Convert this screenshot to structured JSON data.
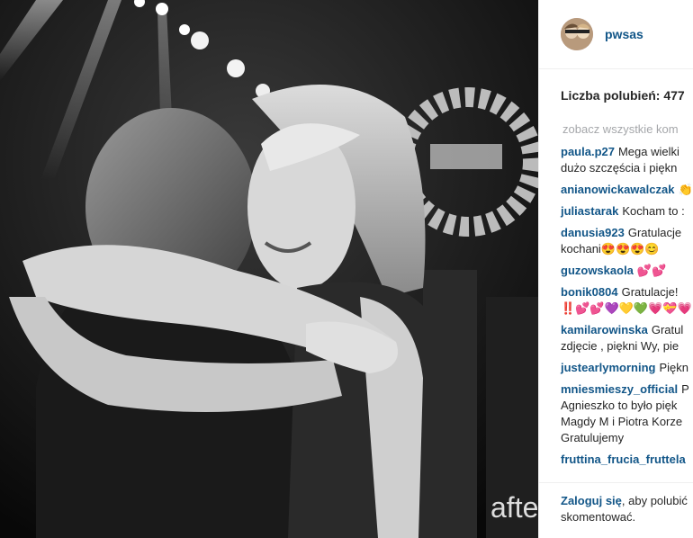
{
  "post": {
    "username": "pwsas",
    "likes_text": "Liczba polubień: 477",
    "view_all": "zobacz wszystkie kom",
    "watermark": "afte",
    "comments": [
      {
        "user": "paula.p27",
        "lines": [
          "Mega wielki",
          "dużo szczęścia i piękn"
        ]
      },
      {
        "user": "anianowickawalczak",
        "lines": [
          "👏"
        ]
      },
      {
        "user": "juliastarak",
        "lines": [
          "Kocham to :"
        ]
      },
      {
        "user": "danusia923",
        "lines": [
          "Gratulacje",
          "kochani😍😍😍😊"
        ]
      },
      {
        "user": "guzowskaola",
        "lines": [
          "💕💕"
        ]
      },
      {
        "user": "bonik0804",
        "lines": [
          "Gratulacje!",
          "‼️💕💕💜💛💚💗💝💗"
        ]
      },
      {
        "user": "kamilarowinska",
        "lines": [
          "Gratul",
          "zdjęcie , piękni Wy, pie"
        ]
      },
      {
        "user": "justearlymorning",
        "lines": [
          "Piękn"
        ]
      },
      {
        "user": "mniesmieszy_official",
        "lines": [
          "P",
          "Agnieszko to było pięk",
          "Magdy M i Piotra Korze",
          "Gratulujemy"
        ]
      },
      {
        "user": "fruttina_frucia_fruttela",
        "lines": [
          ""
        ]
      }
    ],
    "login_link": "Zaloguj się",
    "login_text": ", aby polubić",
    "login_text2": "skomentować."
  }
}
